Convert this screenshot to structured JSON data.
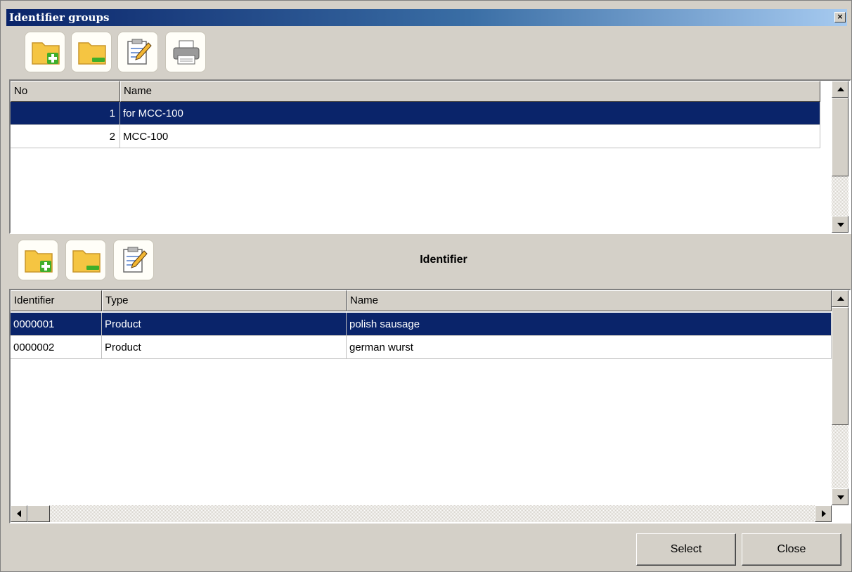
{
  "window": {
    "title": "Identifier groups",
    "close_glyph": "×"
  },
  "groups_toolbar": {
    "icons": [
      "folder-add-icon",
      "folder-remove-icon",
      "edit-note-icon",
      "printer-icon"
    ]
  },
  "groups_table": {
    "columns": [
      "No",
      "Name"
    ],
    "rows": [
      {
        "no": "1",
        "name": "for MCC-100",
        "selected": true
      },
      {
        "no": "2",
        "name": "MCC-100",
        "selected": false
      }
    ]
  },
  "identifier_toolbar": {
    "icons": [
      "folder-add-icon",
      "folder-remove-icon",
      "edit-note-icon"
    ],
    "section_title": "Identifier"
  },
  "identifier_table": {
    "columns": [
      "Identifier",
      "Type",
      "Name"
    ],
    "rows": [
      {
        "identifier": "0000001",
        "type": "Product",
        "name": "polish sausage",
        "selected": true
      },
      {
        "identifier": "0000002",
        "type": "Product",
        "name": "german wurst",
        "selected": false
      }
    ]
  },
  "footer": {
    "select_label": "Select",
    "close_label": "Close"
  },
  "colors": {
    "selection": "#0a246a",
    "title_start": "#0a246a",
    "title_end": "#a6caf0",
    "folder": "#f5c542",
    "add_green": "#3fae2a"
  }
}
